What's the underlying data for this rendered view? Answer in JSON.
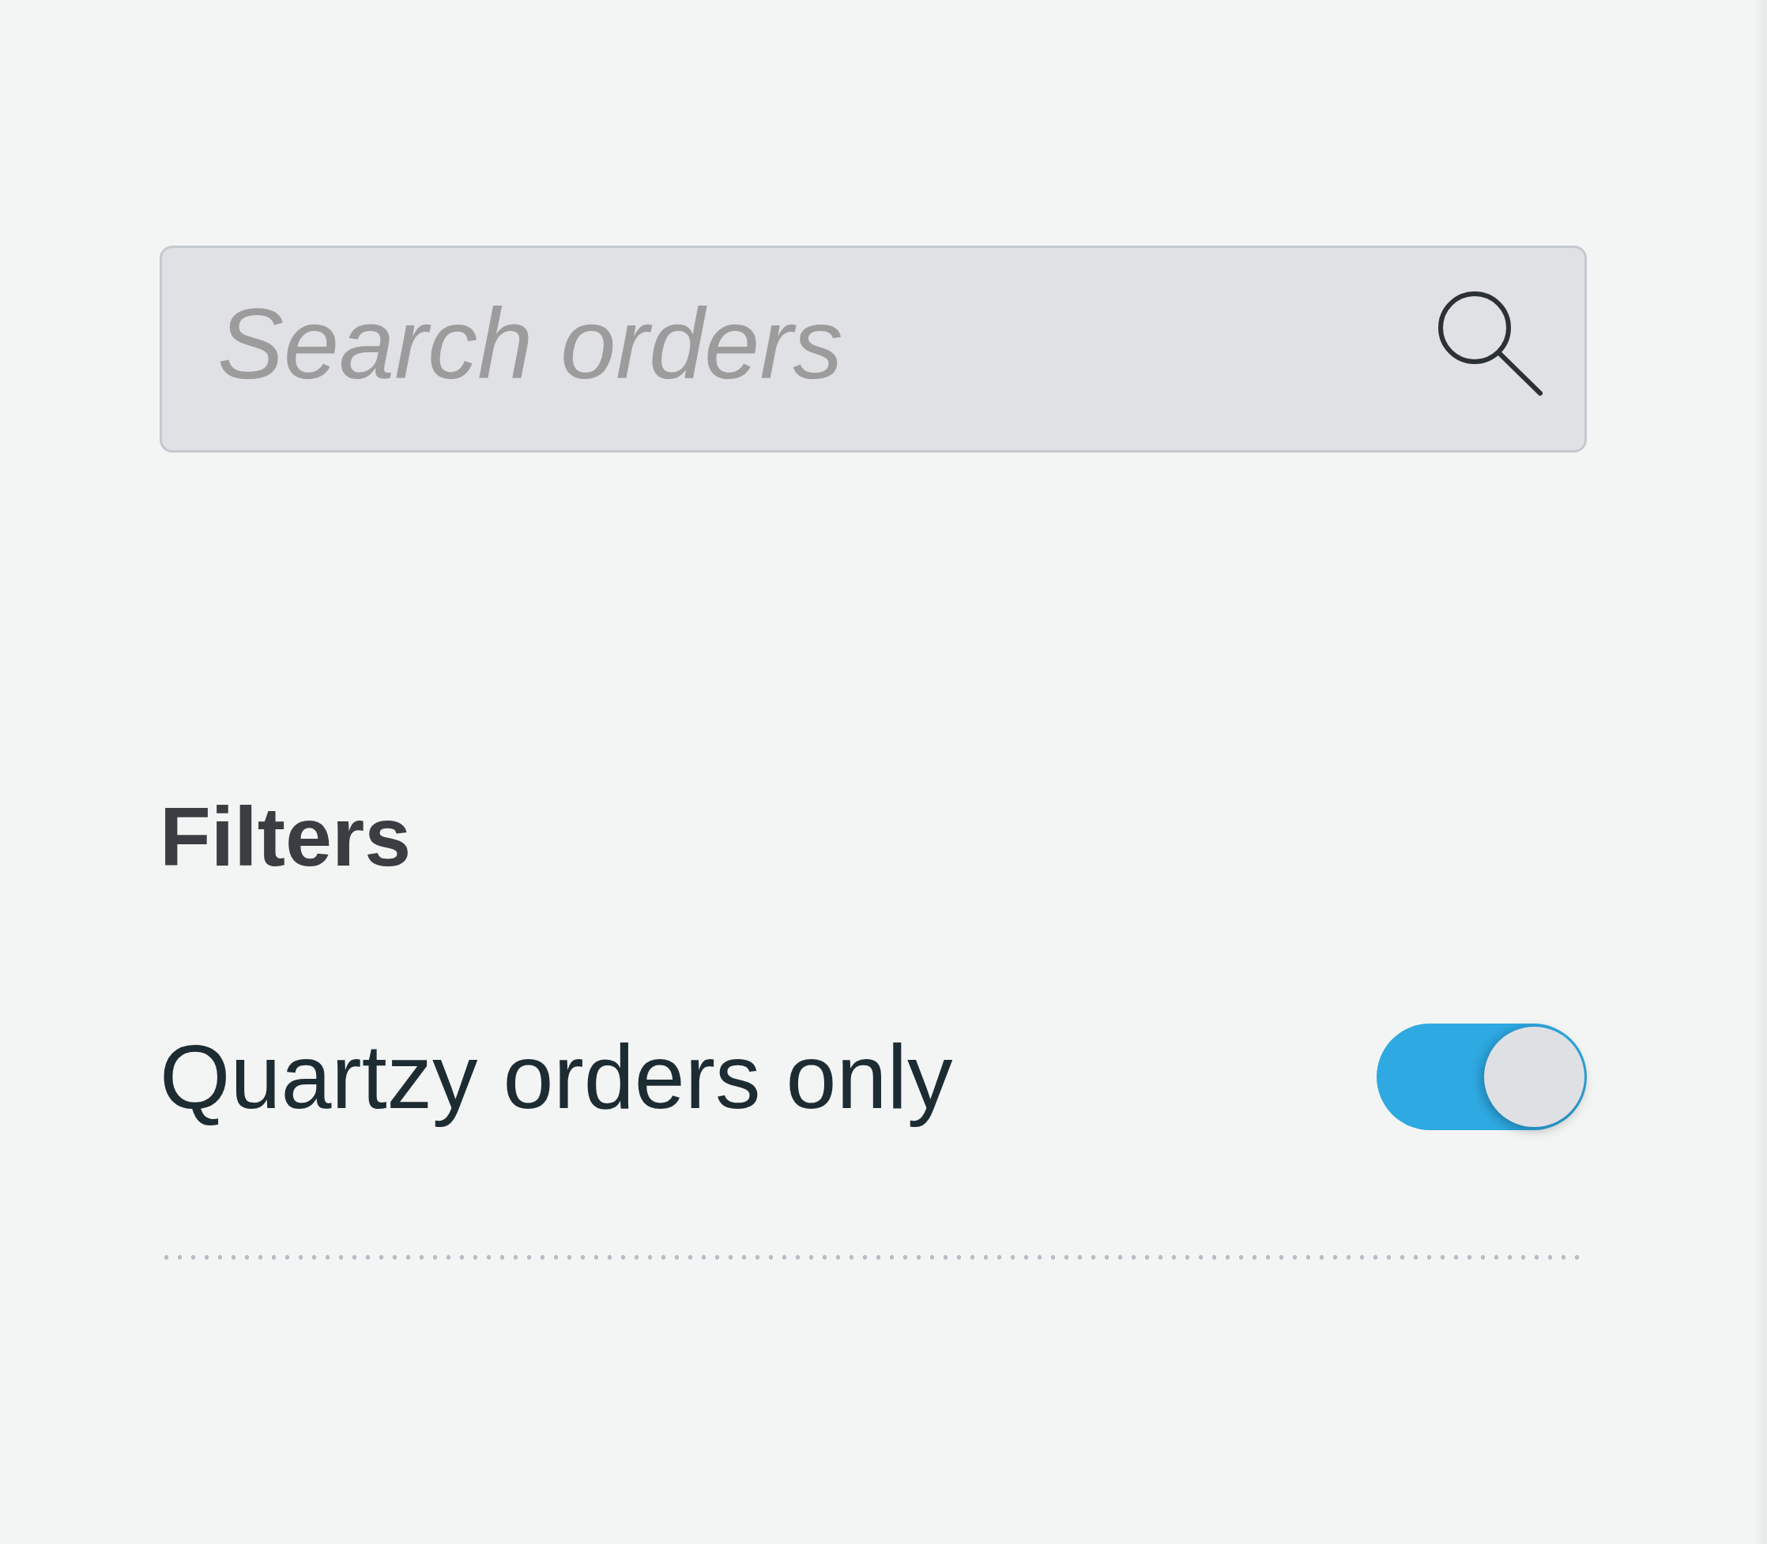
{
  "search": {
    "placeholder": "Search orders"
  },
  "filters": {
    "title": "Filters",
    "items": [
      {
        "label": "Quartzy orders only",
        "on": true
      }
    ]
  }
}
